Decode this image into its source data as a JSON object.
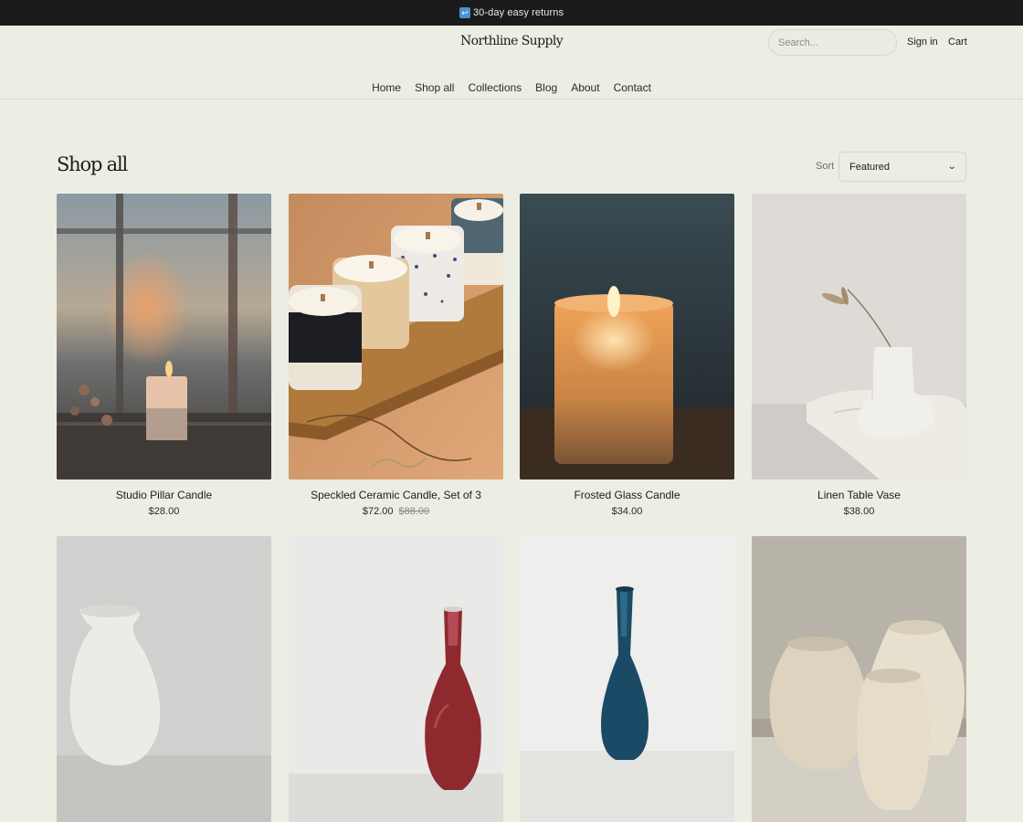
{
  "announcement": {
    "text": "30-day easy returns",
    "icon": "return-arrow-icon"
  },
  "header": {
    "brand": "Northline Supply",
    "search_placeholder": "Search...",
    "sign_in": "Sign in",
    "cart": "Cart"
  },
  "nav": [
    "Home",
    "Shop all",
    "Collections",
    "Blog",
    "About",
    "Contact"
  ],
  "page": {
    "title": "Shop all",
    "sort_label": "Sort",
    "sort_value": "Featured"
  },
  "products": [
    {
      "name": "Studio Pillar Candle",
      "price": "$28.00",
      "compare_price": ""
    },
    {
      "name": "Speckled Ceramic Candle, Set of 3",
      "price": "$72.00",
      "compare_price": "$88.00"
    },
    {
      "name": "Frosted Glass Candle",
      "price": "$34.00",
      "compare_price": ""
    },
    {
      "name": "Linen Table Vase",
      "price": "$38.00",
      "compare_price": ""
    }
  ],
  "colors": {
    "background": "#eceee3",
    "announcement_bar": "#1b1b1b",
    "text": "#1c1c1c"
  }
}
